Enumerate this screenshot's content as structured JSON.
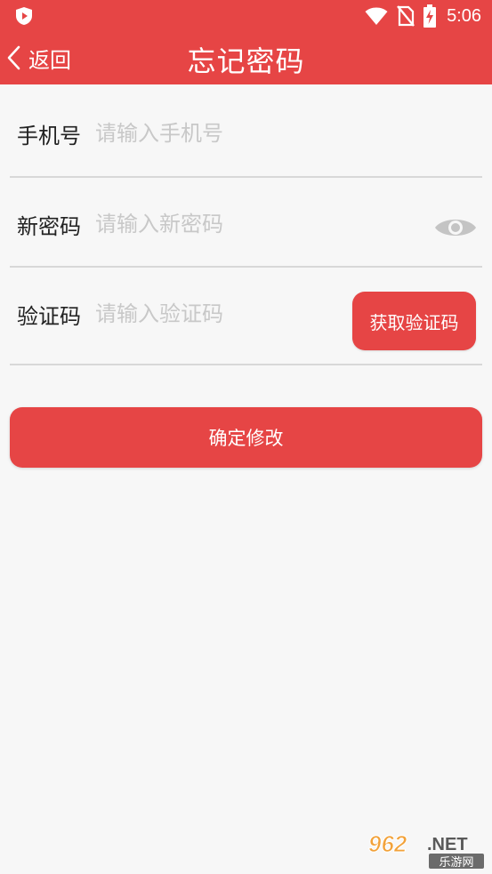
{
  "status_bar": {
    "time": "5:06",
    "icons": [
      "shield-play-icon",
      "wifi-icon",
      "no-sim-icon",
      "battery-charging-icon"
    ]
  },
  "app_bar": {
    "back_label": "返回",
    "title": "忘记密码"
  },
  "form": {
    "phone": {
      "label": "手机号",
      "placeholder": "请输入手机号",
      "value": ""
    },
    "password": {
      "label": "新密码",
      "placeholder": "请输入新密码",
      "value": "",
      "toggle_icon": "eye-icon"
    },
    "code": {
      "label": "验证码",
      "placeholder": "请输入验证码",
      "value": "",
      "button_label": "获取验证码"
    }
  },
  "submit_label": "确定修改",
  "watermark": {
    "brand": "962",
    "suffix": ".NET",
    "site_name": "乐游网"
  },
  "colors": {
    "primary": "#e64545",
    "background": "#f7f7f7",
    "divider": "#d8d8d8",
    "placeholder": "#c8c8c8"
  }
}
